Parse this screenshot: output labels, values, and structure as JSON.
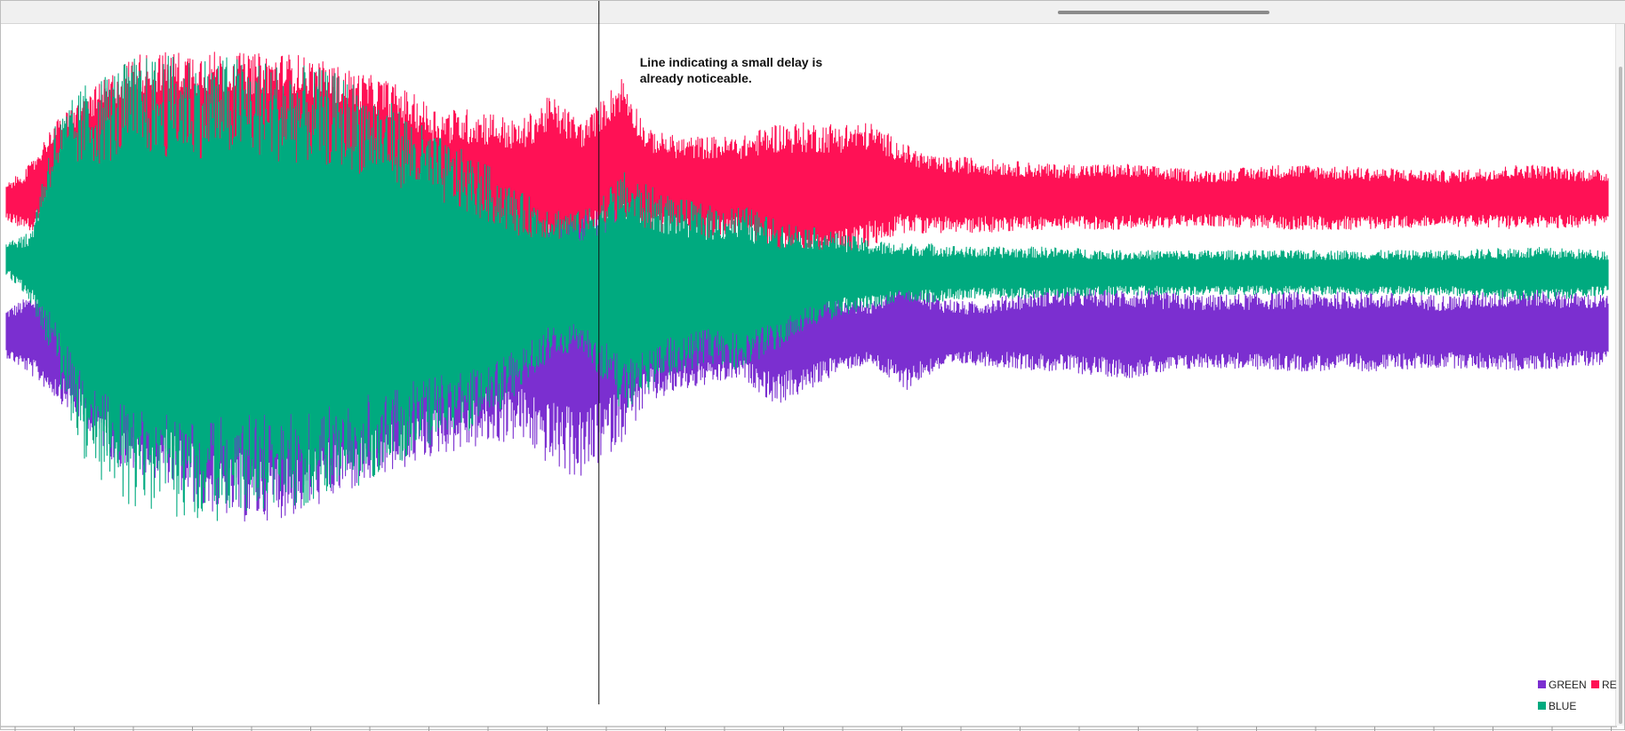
{
  "chart_data": {
    "type": "line",
    "title": "",
    "xlabel": "",
    "ylabel": "",
    "x_range": [
      0,
      1000
    ],
    "y_range": [
      0,
      1000
    ],
    "grid": false,
    "legend_placement": "bottom-right",
    "series": [
      {
        "name": "GREEN",
        "color": "#7b2fd0",
        "envelope": [
          [
            0,
            520,
            590
          ],
          [
            15,
            495,
            610
          ],
          [
            50,
            420,
            640
          ],
          [
            70,
            360,
            680
          ],
          [
            100,
            340,
            700
          ],
          [
            120,
            300,
            720
          ],
          [
            150,
            280,
            730
          ],
          [
            180,
            290,
            720
          ],
          [
            210,
            320,
            700
          ],
          [
            240,
            350,
            690
          ],
          [
            270,
            380,
            700
          ],
          [
            300,
            390,
            740
          ],
          [
            320,
            400,
            760
          ],
          [
            340,
            360,
            790
          ],
          [
            360,
            340,
            800
          ],
          [
            385,
            400,
            740
          ],
          [
            400,
            450,
            690
          ],
          [
            420,
            470,
            650
          ],
          [
            440,
            480,
            630
          ],
          [
            460,
            490,
            610
          ],
          [
            480,
            450,
            660
          ],
          [
            500,
            470,
            640
          ],
          [
            520,
            500,
            610
          ],
          [
            540,
            510,
            600
          ],
          [
            560,
            470,
            650
          ],
          [
            580,
            500,
            610
          ],
          [
            600,
            510,
            600
          ],
          [
            650,
            500,
            620
          ],
          [
            700,
            490,
            620
          ],
          [
            750,
            505,
            610
          ],
          [
            800,
            500,
            615
          ],
          [
            850,
            500,
            615
          ],
          [
            900,
            505,
            610
          ],
          [
            950,
            500,
            620
          ],
          [
            1000,
            510,
            610
          ]
        ]
      },
      {
        "name": "RE",
        "color": "#ff1155",
        "envelope": [
          [
            0,
            720,
            770
          ],
          [
            15,
            700,
            800
          ],
          [
            30,
            740,
            860
          ],
          [
            50,
            720,
            900
          ],
          [
            80,
            700,
            960
          ],
          [
            120,
            680,
            965
          ],
          [
            150,
            690,
            960
          ],
          [
            180,
            700,
            960
          ],
          [
            210,
            690,
            940
          ],
          [
            240,
            680,
            920
          ],
          [
            270,
            650,
            880
          ],
          [
            300,
            640,
            880
          ],
          [
            320,
            660,
            860
          ],
          [
            340,
            660,
            900
          ],
          [
            360,
            690,
            860
          ],
          [
            385,
            690,
            930
          ],
          [
            400,
            700,
            850
          ],
          [
            420,
            690,
            840
          ],
          [
            440,
            690,
            840
          ],
          [
            460,
            690,
            840
          ],
          [
            480,
            660,
            860
          ],
          [
            500,
            660,
            860
          ],
          [
            520,
            660,
            860
          ],
          [
            540,
            680,
            860
          ],
          [
            560,
            700,
            830
          ],
          [
            580,
            700,
            810
          ],
          [
            600,
            700,
            810
          ],
          [
            650,
            705,
            800
          ],
          [
            700,
            705,
            800
          ],
          [
            750,
            710,
            790
          ],
          [
            800,
            705,
            800
          ],
          [
            850,
            705,
            795
          ],
          [
            900,
            710,
            790
          ],
          [
            950,
            705,
            800
          ],
          [
            1000,
            710,
            790
          ]
        ]
      },
      {
        "name": "BLUE",
        "color": "#00aa7f",
        "envelope": [
          [
            0,
            640,
            690
          ],
          [
            15,
            600,
            700
          ],
          [
            30,
            500,
            860
          ],
          [
            50,
            360,
            920
          ],
          [
            80,
            300,
            955
          ],
          [
            120,
            280,
            960
          ],
          [
            150,
            290,
            955
          ],
          [
            180,
            300,
            945
          ],
          [
            210,
            320,
            930
          ],
          [
            240,
            360,
            890
          ],
          [
            270,
            400,
            840
          ],
          [
            300,
            420,
            800
          ],
          [
            320,
            470,
            760
          ],
          [
            340,
            520,
            740
          ],
          [
            360,
            530,
            730
          ],
          [
            385,
            440,
            790
          ],
          [
            400,
            470,
            770
          ],
          [
            420,
            500,
            750
          ],
          [
            440,
            510,
            740
          ],
          [
            460,
            500,
            740
          ],
          [
            480,
            530,
            720
          ],
          [
            500,
            560,
            710
          ],
          [
            520,
            580,
            700
          ],
          [
            540,
            590,
            690
          ],
          [
            560,
            600,
            685
          ],
          [
            580,
            600,
            685
          ],
          [
            600,
            605,
            680
          ],
          [
            650,
            605,
            680
          ],
          [
            700,
            610,
            675
          ],
          [
            750,
            610,
            675
          ],
          [
            800,
            610,
            675
          ],
          [
            850,
            610,
            675
          ],
          [
            900,
            610,
            675
          ],
          [
            950,
            600,
            680
          ],
          [
            1000,
            610,
            675
          ]
        ]
      }
    ],
    "annotations": [
      {
        "x": 370,
        "line1": "Line indicating a small delay is",
        "line2": "already noticeable."
      }
    ]
  }
}
